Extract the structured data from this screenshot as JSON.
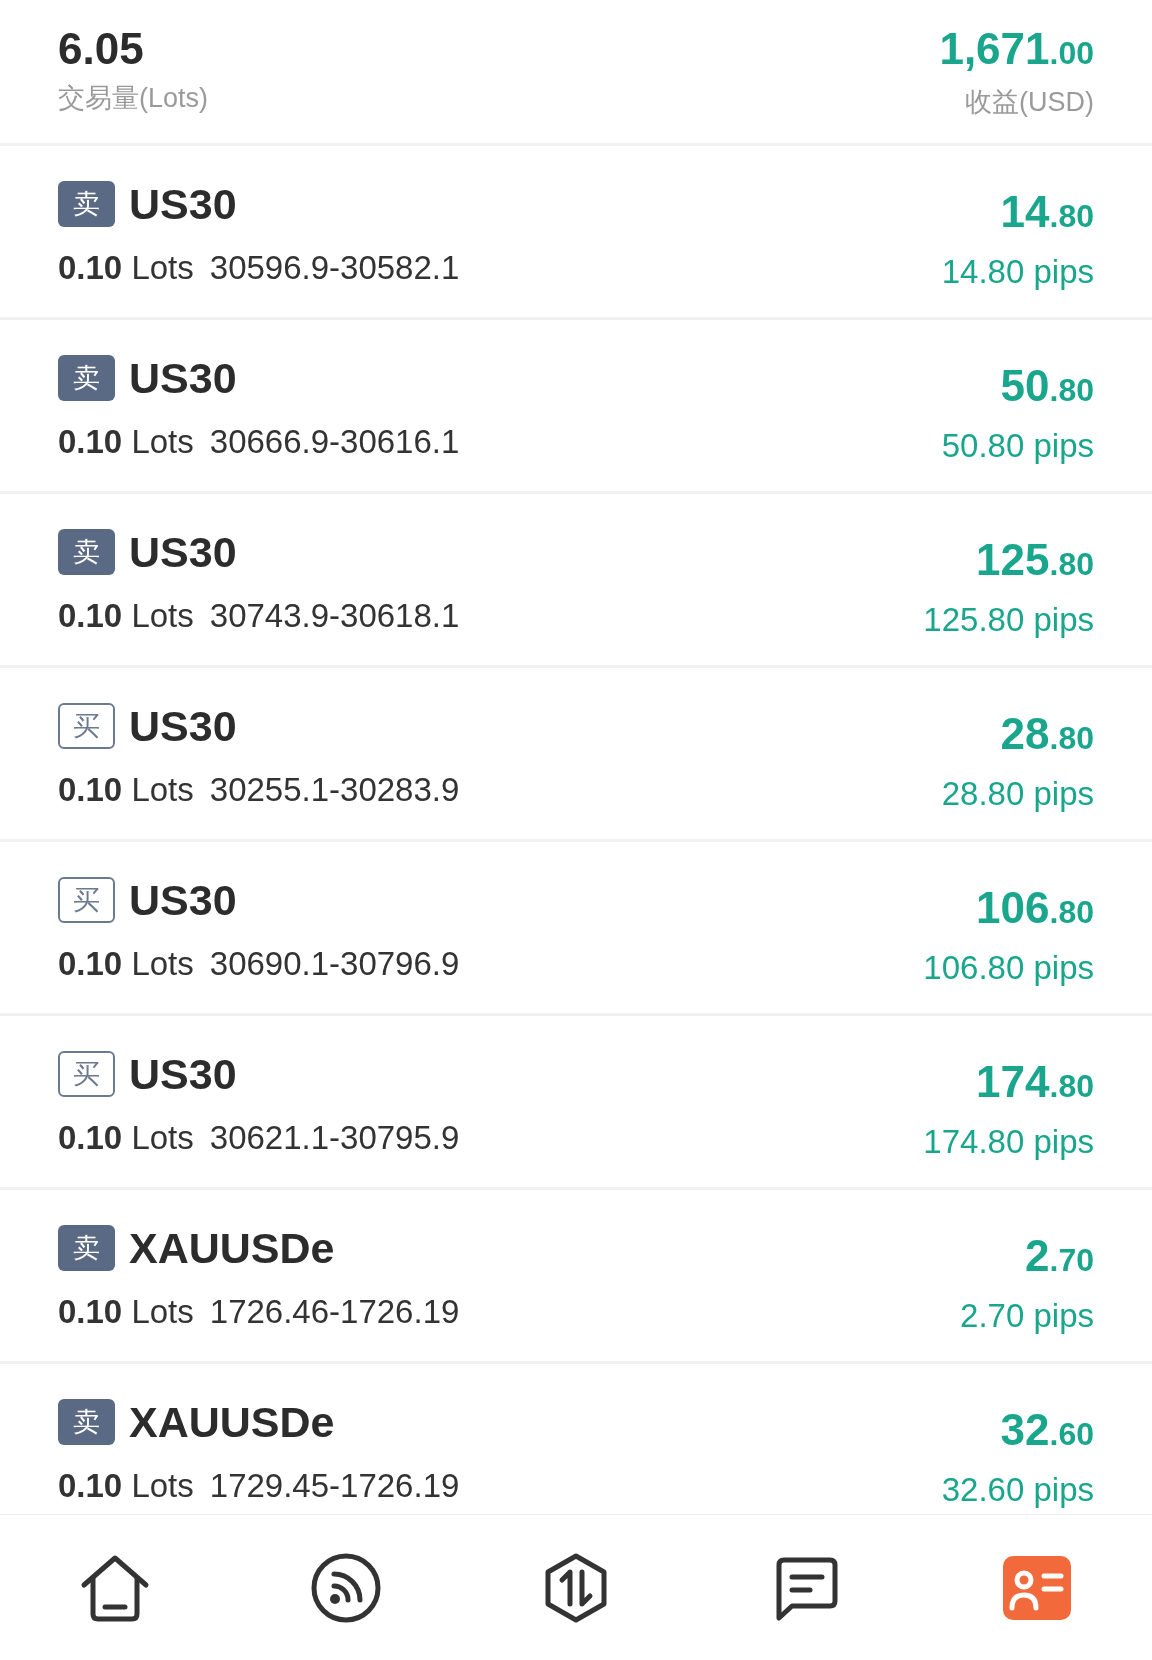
{
  "summary": {
    "volume": "6.05",
    "volume_label": "交易量(Lots)",
    "profit_main": "1,671",
    "profit_fraction": ".00",
    "profit_label": "收益(USD)"
  },
  "trades": [
    {
      "kind": "sell",
      "badge": "卖",
      "symbol": "US30",
      "lots": "**0.10** Lots",
      "price_range": "30596.9-30582.1",
      "profit_main": "14",
      "profit_fraction": ".80",
      "pips": "14.80 pips"
    },
    {
      "kind": "sell",
      "badge": "卖",
      "symbol": "US30",
      "lots": "**0.10** Lots",
      "price_range": "30666.9-30616.1",
      "profit_main": "50",
      "profit_fraction": ".80",
      "pips": "50.80 pips"
    },
    {
      "kind": "sell",
      "badge": "卖",
      "symbol": "US30",
      "lots": "**0.10** Lots",
      "price_range": "30743.9-30618.1",
      "profit_main": "125",
      "profit_fraction": ".80",
      "pips": "125.80 pips"
    },
    {
      "kind": "buy",
      "badge": "买",
      "symbol": "US30",
      "lots": "**0.10** Lots",
      "price_range": "30255.1-30283.9",
      "profit_main": "28",
      "profit_fraction": ".80",
      "pips": "28.80 pips"
    },
    {
      "kind": "buy",
      "badge": "买",
      "symbol": "US30",
      "lots": "**0.10** Lots",
      "price_range": "30690.1-30796.9",
      "profit_main": "106",
      "profit_fraction": ".80",
      "pips": "106.80 pips"
    },
    {
      "kind": "buy",
      "badge": "买",
      "symbol": "US30",
      "lots": "**0.10** Lots",
      "price_range": "30621.1-30795.9",
      "profit_main": "174",
      "profit_fraction": ".80",
      "pips": "174.80 pips"
    },
    {
      "kind": "sell",
      "badge": "卖",
      "symbol": "XAUUSDe",
      "lots": "**0.10** Lots",
      "price_range": "1726.46-1726.19",
      "profit_main": "2",
      "profit_fraction": ".70",
      "pips": "2.70 pips"
    },
    {
      "kind": "sell",
      "badge": "卖",
      "symbol": "XAUUSDe",
      "lots": "**0.10** Lots",
      "price_range": "1729.45-1726.19",
      "profit_main": "32",
      "profit_fraction": ".60",
      "pips": "32.60 pips"
    }
  ],
  "nav": {
    "items": [
      {
        "selected": false
      },
      {
        "selected": false
      },
      {
        "selected": false
      },
      {
        "selected": false
      },
      {
        "selected": true
      }
    ]
  }
}
